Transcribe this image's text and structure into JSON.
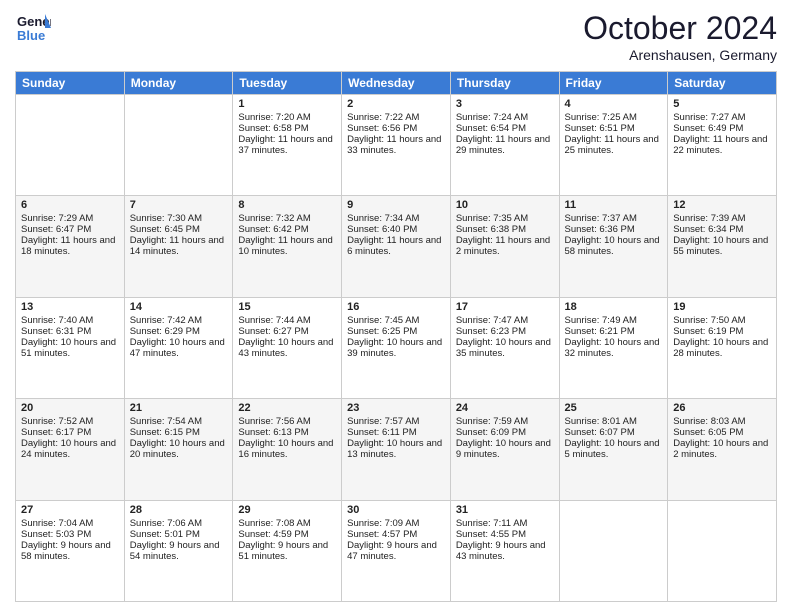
{
  "header": {
    "logo_general": "General",
    "logo_blue": "Blue",
    "title": "October 2024",
    "subtitle": "Arenshausen, Germany"
  },
  "weekdays": [
    "Sunday",
    "Monday",
    "Tuesday",
    "Wednesday",
    "Thursday",
    "Friday",
    "Saturday"
  ],
  "weeks": [
    [
      {
        "day": "",
        "sunrise": "",
        "sunset": "",
        "daylight": ""
      },
      {
        "day": "",
        "sunrise": "",
        "sunset": "",
        "daylight": ""
      },
      {
        "day": "1",
        "sunrise": "Sunrise: 7:20 AM",
        "sunset": "Sunset: 6:58 PM",
        "daylight": "Daylight: 11 hours and 37 minutes."
      },
      {
        "day": "2",
        "sunrise": "Sunrise: 7:22 AM",
        "sunset": "Sunset: 6:56 PM",
        "daylight": "Daylight: 11 hours and 33 minutes."
      },
      {
        "day": "3",
        "sunrise": "Sunrise: 7:24 AM",
        "sunset": "Sunset: 6:54 PM",
        "daylight": "Daylight: 11 hours and 29 minutes."
      },
      {
        "day": "4",
        "sunrise": "Sunrise: 7:25 AM",
        "sunset": "Sunset: 6:51 PM",
        "daylight": "Daylight: 11 hours and 25 minutes."
      },
      {
        "day": "5",
        "sunrise": "Sunrise: 7:27 AM",
        "sunset": "Sunset: 6:49 PM",
        "daylight": "Daylight: 11 hours and 22 minutes."
      }
    ],
    [
      {
        "day": "6",
        "sunrise": "Sunrise: 7:29 AM",
        "sunset": "Sunset: 6:47 PM",
        "daylight": "Daylight: 11 hours and 18 minutes."
      },
      {
        "day": "7",
        "sunrise": "Sunrise: 7:30 AM",
        "sunset": "Sunset: 6:45 PM",
        "daylight": "Daylight: 11 hours and 14 minutes."
      },
      {
        "day": "8",
        "sunrise": "Sunrise: 7:32 AM",
        "sunset": "Sunset: 6:42 PM",
        "daylight": "Daylight: 11 hours and 10 minutes."
      },
      {
        "day": "9",
        "sunrise": "Sunrise: 7:34 AM",
        "sunset": "Sunset: 6:40 PM",
        "daylight": "Daylight: 11 hours and 6 minutes."
      },
      {
        "day": "10",
        "sunrise": "Sunrise: 7:35 AM",
        "sunset": "Sunset: 6:38 PM",
        "daylight": "Daylight: 11 hours and 2 minutes."
      },
      {
        "day": "11",
        "sunrise": "Sunrise: 7:37 AM",
        "sunset": "Sunset: 6:36 PM",
        "daylight": "Daylight: 10 hours and 58 minutes."
      },
      {
        "day": "12",
        "sunrise": "Sunrise: 7:39 AM",
        "sunset": "Sunset: 6:34 PM",
        "daylight": "Daylight: 10 hours and 55 minutes."
      }
    ],
    [
      {
        "day": "13",
        "sunrise": "Sunrise: 7:40 AM",
        "sunset": "Sunset: 6:31 PM",
        "daylight": "Daylight: 10 hours and 51 minutes."
      },
      {
        "day": "14",
        "sunrise": "Sunrise: 7:42 AM",
        "sunset": "Sunset: 6:29 PM",
        "daylight": "Daylight: 10 hours and 47 minutes."
      },
      {
        "day": "15",
        "sunrise": "Sunrise: 7:44 AM",
        "sunset": "Sunset: 6:27 PM",
        "daylight": "Daylight: 10 hours and 43 minutes."
      },
      {
        "day": "16",
        "sunrise": "Sunrise: 7:45 AM",
        "sunset": "Sunset: 6:25 PM",
        "daylight": "Daylight: 10 hours and 39 minutes."
      },
      {
        "day": "17",
        "sunrise": "Sunrise: 7:47 AM",
        "sunset": "Sunset: 6:23 PM",
        "daylight": "Daylight: 10 hours and 35 minutes."
      },
      {
        "day": "18",
        "sunrise": "Sunrise: 7:49 AM",
        "sunset": "Sunset: 6:21 PM",
        "daylight": "Daylight: 10 hours and 32 minutes."
      },
      {
        "day": "19",
        "sunrise": "Sunrise: 7:50 AM",
        "sunset": "Sunset: 6:19 PM",
        "daylight": "Daylight: 10 hours and 28 minutes."
      }
    ],
    [
      {
        "day": "20",
        "sunrise": "Sunrise: 7:52 AM",
        "sunset": "Sunset: 6:17 PM",
        "daylight": "Daylight: 10 hours and 24 minutes."
      },
      {
        "day": "21",
        "sunrise": "Sunrise: 7:54 AM",
        "sunset": "Sunset: 6:15 PM",
        "daylight": "Daylight: 10 hours and 20 minutes."
      },
      {
        "day": "22",
        "sunrise": "Sunrise: 7:56 AM",
        "sunset": "Sunset: 6:13 PM",
        "daylight": "Daylight: 10 hours and 16 minutes."
      },
      {
        "day": "23",
        "sunrise": "Sunrise: 7:57 AM",
        "sunset": "Sunset: 6:11 PM",
        "daylight": "Daylight: 10 hours and 13 minutes."
      },
      {
        "day": "24",
        "sunrise": "Sunrise: 7:59 AM",
        "sunset": "Sunset: 6:09 PM",
        "daylight": "Daylight: 10 hours and 9 minutes."
      },
      {
        "day": "25",
        "sunrise": "Sunrise: 8:01 AM",
        "sunset": "Sunset: 6:07 PM",
        "daylight": "Daylight: 10 hours and 5 minutes."
      },
      {
        "day": "26",
        "sunrise": "Sunrise: 8:03 AM",
        "sunset": "Sunset: 6:05 PM",
        "daylight": "Daylight: 10 hours and 2 minutes."
      }
    ],
    [
      {
        "day": "27",
        "sunrise": "Sunrise: 7:04 AM",
        "sunset": "Sunset: 5:03 PM",
        "daylight": "Daylight: 9 hours and 58 minutes."
      },
      {
        "day": "28",
        "sunrise": "Sunrise: 7:06 AM",
        "sunset": "Sunset: 5:01 PM",
        "daylight": "Daylight: 9 hours and 54 minutes."
      },
      {
        "day": "29",
        "sunrise": "Sunrise: 7:08 AM",
        "sunset": "Sunset: 4:59 PM",
        "daylight": "Daylight: 9 hours and 51 minutes."
      },
      {
        "day": "30",
        "sunrise": "Sunrise: 7:09 AM",
        "sunset": "Sunset: 4:57 PM",
        "daylight": "Daylight: 9 hours and 47 minutes."
      },
      {
        "day": "31",
        "sunrise": "Sunrise: 7:11 AM",
        "sunset": "Sunset: 4:55 PM",
        "daylight": "Daylight: 9 hours and 43 minutes."
      },
      {
        "day": "",
        "sunrise": "",
        "sunset": "",
        "daylight": ""
      },
      {
        "day": "",
        "sunrise": "",
        "sunset": "",
        "daylight": ""
      }
    ]
  ]
}
